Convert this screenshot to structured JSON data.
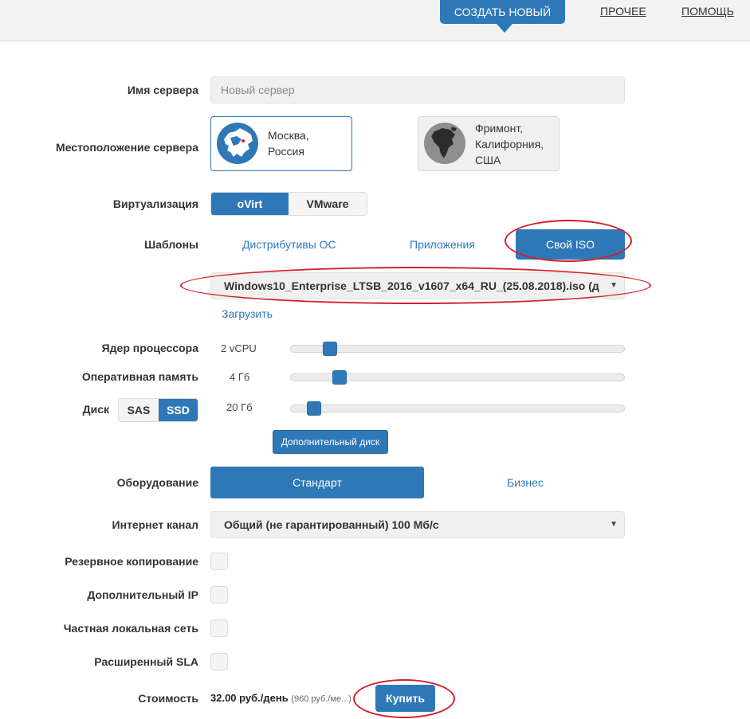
{
  "header": {
    "create_new": "СОЗДАТЬ НОВЫЙ",
    "other": "ПРОЧЕЕ",
    "help": "ПОМОЩЬ"
  },
  "form": {
    "server_name": {
      "label": "Имя сервера",
      "placeholder": "Новый сервер",
      "value": ""
    },
    "location": {
      "label": "Местоположение сервера",
      "options": [
        {
          "line1": "Москва,",
          "line2": "Россия",
          "line3": "",
          "selected": true
        },
        {
          "line1": "Фримонт,",
          "line2": "Калифорния,",
          "line3": "США",
          "selected": false
        }
      ]
    },
    "virtualization": {
      "label": "Виртуализация",
      "options": [
        "oVirt",
        "VMware"
      ],
      "selected": "oVirt"
    },
    "templates": {
      "label": "Шаблоны",
      "tabs": [
        "Дистрибутивы ОС",
        "Приложения",
        "Свой ISO"
      ],
      "selected": "Свой ISO",
      "iso_value": "Windows10_Enterprise_LTSB_2016_v1607_x64_RU_(25.08.2018).iso (д",
      "upload_link": "Загрузить"
    },
    "cpu": {
      "label": "Ядер процессора",
      "value": "2 vCPU",
      "level": 0.1
    },
    "ram": {
      "label": "Оперативная память",
      "value": "4 Гб",
      "level": 0.13
    },
    "disk": {
      "label": "Диск",
      "types": [
        "SAS",
        "SSD"
      ],
      "selected_type": "SSD",
      "value": "20 Гб",
      "level": 0.05
    },
    "extra_disk_button": "Дополнительный диск",
    "hardware": {
      "label": "Оборудование",
      "options": [
        "Стандарт",
        "Бизнес"
      ],
      "selected": "Стандарт"
    },
    "internet": {
      "label": "Интернет канал",
      "value": "Общий (не гарантированный) 100 Мб/с"
    },
    "backup": {
      "label": "Резервное копирование",
      "checked": false
    },
    "extra_ip": {
      "label": "Дополнительный IP",
      "checked": false
    },
    "private_net": {
      "label": "Частная локальная сеть",
      "checked": false
    },
    "sla": {
      "label": "Расширенный SLA",
      "checked": false
    },
    "cost": {
      "label": "Стоимость",
      "per_day": "32.00 руб./день",
      "per_month": "(960 руб./ме...)"
    },
    "buy_button": "Купить"
  },
  "colors": {
    "accent": "#2f78b8",
    "annotation": "#d2202a"
  }
}
